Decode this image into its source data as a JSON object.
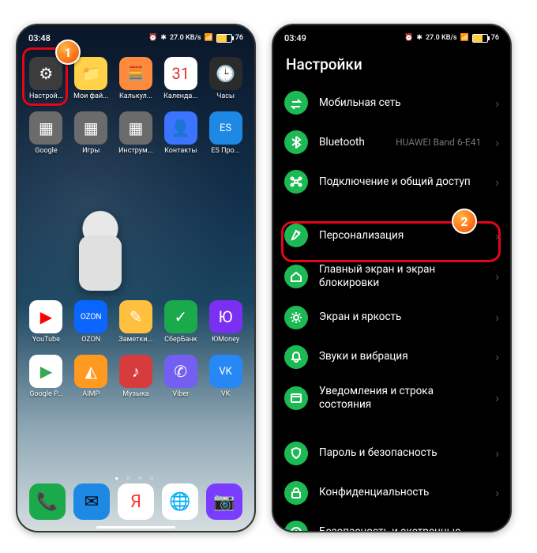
{
  "status": {
    "time_left": "03:48",
    "time_right": "03:49",
    "net": "27.0 KB/s",
    "batt": "76"
  },
  "home": {
    "row1": [
      {
        "label": "Настрой...",
        "bg": "#3c3c3c",
        "glyph": "⚙"
      },
      {
        "label": "Мои фай...",
        "bg": "#ffd24a",
        "glyph": "📁"
      },
      {
        "label": "Калькул...",
        "bg": "#ff8a3d",
        "glyph": "🧮"
      },
      {
        "label": "Календа...",
        "bg": "#ffffff",
        "glyph": "31",
        "fg": "#d33"
      },
      {
        "label": "Часы",
        "bg": "#2b2b2b",
        "glyph": "🕒"
      }
    ],
    "row2": [
      {
        "label": "Google",
        "bg": "#6b6b6b",
        "glyph": "▦"
      },
      {
        "label": "Игры",
        "bg": "#6b6b6b",
        "glyph": "▦"
      },
      {
        "label": "Инструм...",
        "bg": "#6b6b6b",
        "glyph": "▦"
      },
      {
        "label": "Контакты",
        "bg": "#3b74ff",
        "glyph": "👤"
      },
      {
        "label": "ES Про...",
        "bg": "#1e88e5",
        "glyph": "ES",
        "fs": "13px"
      }
    ],
    "row3": [
      {
        "label": "YouTube",
        "bg": "#ffffff",
        "glyph": "▶",
        "fg": "#f00"
      },
      {
        "label": "OZON",
        "bg": "#0a66ff",
        "glyph": "OZON",
        "fs": "10px"
      },
      {
        "label": "Заметки...",
        "bg": "#ffbf3f",
        "glyph": "✎"
      },
      {
        "label": "СберБанк",
        "bg": "#1aa94b",
        "glyph": "✓"
      },
      {
        "label": "ЮMoney",
        "bg": "#7b2ff2",
        "glyph": "Ю"
      }
    ],
    "row4": [
      {
        "label": "Google P...",
        "bg": "#ffffff",
        "glyph": "▶",
        "fg": "#34a853"
      },
      {
        "label": "AIMP",
        "bg": "#ff9a1e",
        "glyph": "◭"
      },
      {
        "label": "Музыка",
        "bg": "#d63c3c",
        "glyph": "♪"
      },
      {
        "label": "Viber",
        "bg": "#7360f2",
        "glyph": "✆"
      },
      {
        "label": "VK",
        "bg": "#2787f5",
        "glyph": "VK",
        "fs": "13px"
      }
    ],
    "dock": [
      {
        "bg": "#1aa94b",
        "glyph": "📞"
      },
      {
        "bg": "#1e88e5",
        "glyph": "✉"
      },
      {
        "bg": "#ffffff",
        "glyph": "Я",
        "fg": "#f33"
      },
      {
        "bg": "#ffffff",
        "glyph": "🌐",
        "fg": "#1e88e5"
      },
      {
        "bg": "#7a3cff",
        "glyph": "📷"
      }
    ]
  },
  "settings": {
    "title": "Настройки",
    "items": [
      {
        "icon": "swap",
        "label": "Мобильная сеть"
      },
      {
        "icon": "bt",
        "label": "Bluetooth",
        "sub": "HUAWEI Band 6-E41"
      },
      {
        "icon": "share",
        "label": "Подключение и общий доступ"
      },
      {
        "gap": true
      },
      {
        "icon": "brush",
        "label": "Персонализация",
        "hl": true
      },
      {
        "icon": "home",
        "label": "Главный экран и экран блокировки"
      },
      {
        "icon": "sun",
        "label": "Экран и яркость"
      },
      {
        "icon": "bell",
        "label": "Звуки и вибрация"
      },
      {
        "icon": "notif",
        "label": "Уведомления и строка состояния"
      },
      {
        "gap": true
      },
      {
        "icon": "shield",
        "label": "Пароль и безопасность"
      },
      {
        "icon": "lock",
        "label": "Конфиденциальность"
      },
      {
        "icon": "sos",
        "label": "Безопасность и экстренные"
      }
    ]
  },
  "steps": {
    "s1": "1",
    "s2": "2"
  }
}
